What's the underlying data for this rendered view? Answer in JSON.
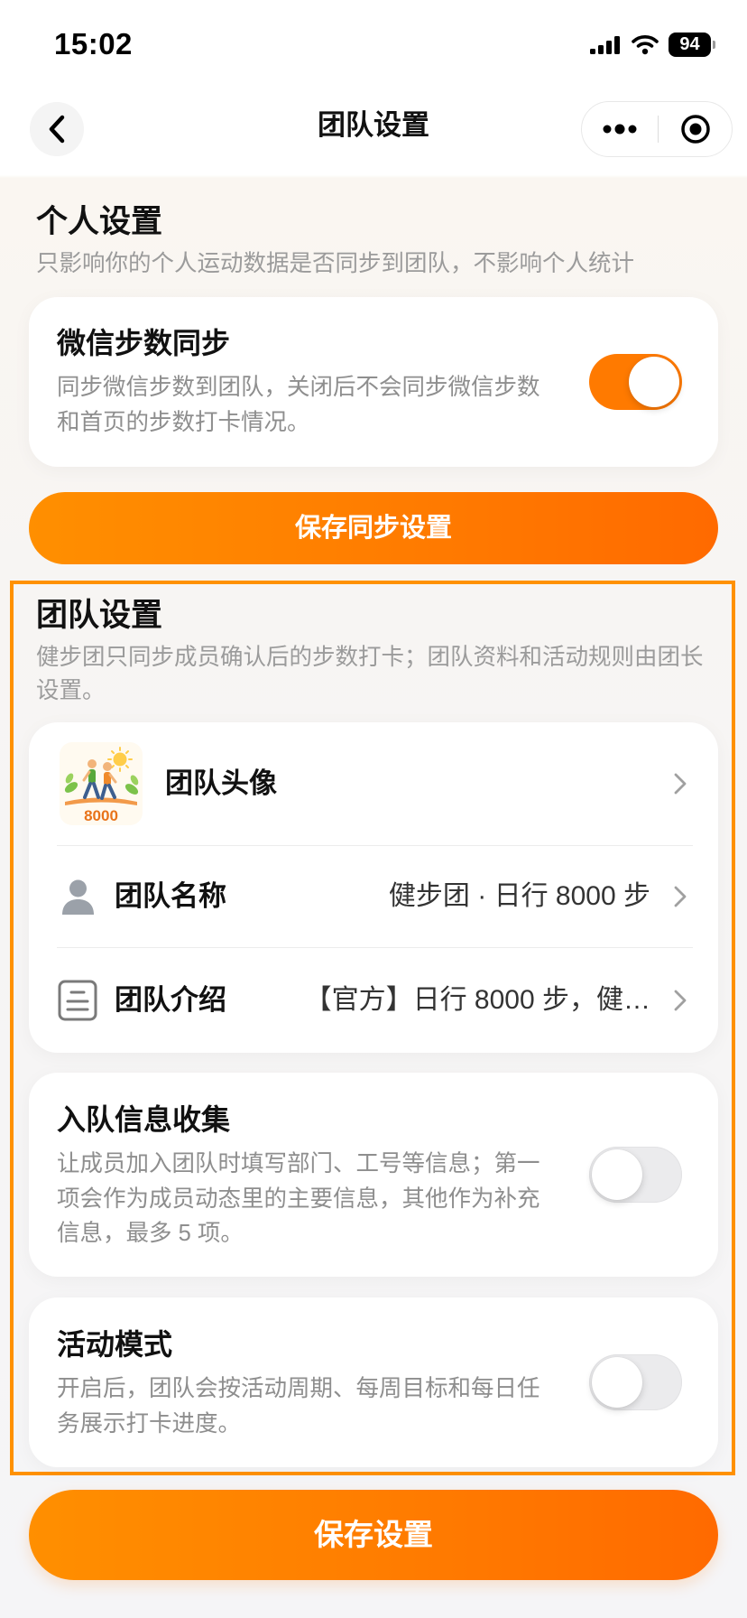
{
  "status_bar": {
    "time": "15:02",
    "battery": "94"
  },
  "nav": {
    "title": "团队设置",
    "back_icon": "chevron-left-icon",
    "more_icon": "more-dots-icon",
    "close_icon": "target-circle-icon"
  },
  "personal": {
    "title": "个人设置",
    "subtitle": "只影响你的个人运动数据是否同步到团队，不影响个人统计",
    "wechat_sync": {
      "title": "微信步数同步",
      "description": "同步微信步数到团队，关闭后不会同步微信步数和首页的步数打卡情况。",
      "enabled": true
    },
    "save_label": "保存同步设置"
  },
  "team": {
    "title": "团队设置",
    "subtitle": "健步团只同步成员确认后的步数打卡；团队资料和活动规则由团长设置。",
    "profile": {
      "avatar": {
        "label": "团队头像",
        "badge_text": "8000"
      },
      "name": {
        "label": "团队名称",
        "value": "健步团 · 日行 8000 步",
        "icon": "person-icon"
      },
      "intro": {
        "label": "团队介绍",
        "value": "【官方】日行 8000 步，健…",
        "icon": "document-icon"
      }
    },
    "join_info": {
      "title": "入队信息收集",
      "description": "让成员加入团队时填写部门、工号等信息；第一项会作为成员动态里的主要信息，其他作为补充信息，最多 5 项。",
      "enabled": false
    },
    "activity_mode": {
      "title": "活动模式",
      "description": "开启后，团队会按活动周期、每周目标和每日任务展示打卡进度。",
      "enabled": false
    }
  },
  "save_label": "保存设置",
  "colors": {
    "accent": "#ff7a00",
    "button_start": "#ff8f00",
    "button_end": "#ff6a00",
    "highlight_border": "#ff9100",
    "toggle_off": "#ebebed"
  }
}
